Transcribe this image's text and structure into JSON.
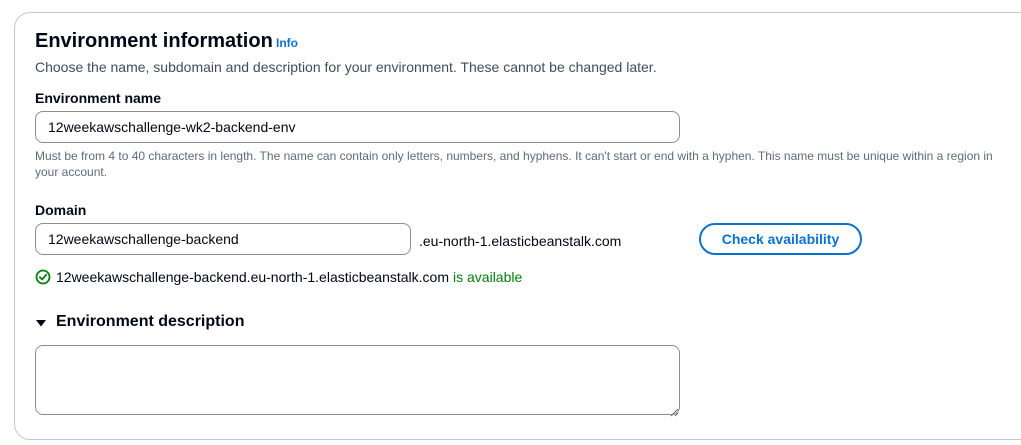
{
  "section": {
    "title": "Environment information",
    "info_link": "Info",
    "description": "Choose the name, subdomain and description for your environment. These cannot be changed later."
  },
  "environment_name": {
    "label": "Environment name",
    "value": "12weekawschallenge-wk2-backend-env",
    "constraint": "Must be from 4 to 40 characters in length. The name can contain only letters, numbers, and hyphens. It can't start or end with a hyphen. This name must be unique within a region in your account."
  },
  "domain": {
    "label": "Domain",
    "value": "12weekawschallenge-backend",
    "suffix": ".eu-north-1.elasticbeanstalk.com",
    "check_button": "Check availability",
    "status_icon": "check-circle-icon",
    "status_domain": "12weekawschallenge-backend.eu-north-1.elasticbeanstalk.com",
    "status_text": "is available"
  },
  "environment_description": {
    "label": "Environment description",
    "value": "",
    "caret_icon": "caret-down-icon"
  },
  "colors": {
    "link": "#0972d3",
    "success": "#037f0c",
    "border": "#8c8c94",
    "card_border": "#c6c6cd",
    "text": "#000716",
    "secondary_text": "#5f6b7a"
  }
}
